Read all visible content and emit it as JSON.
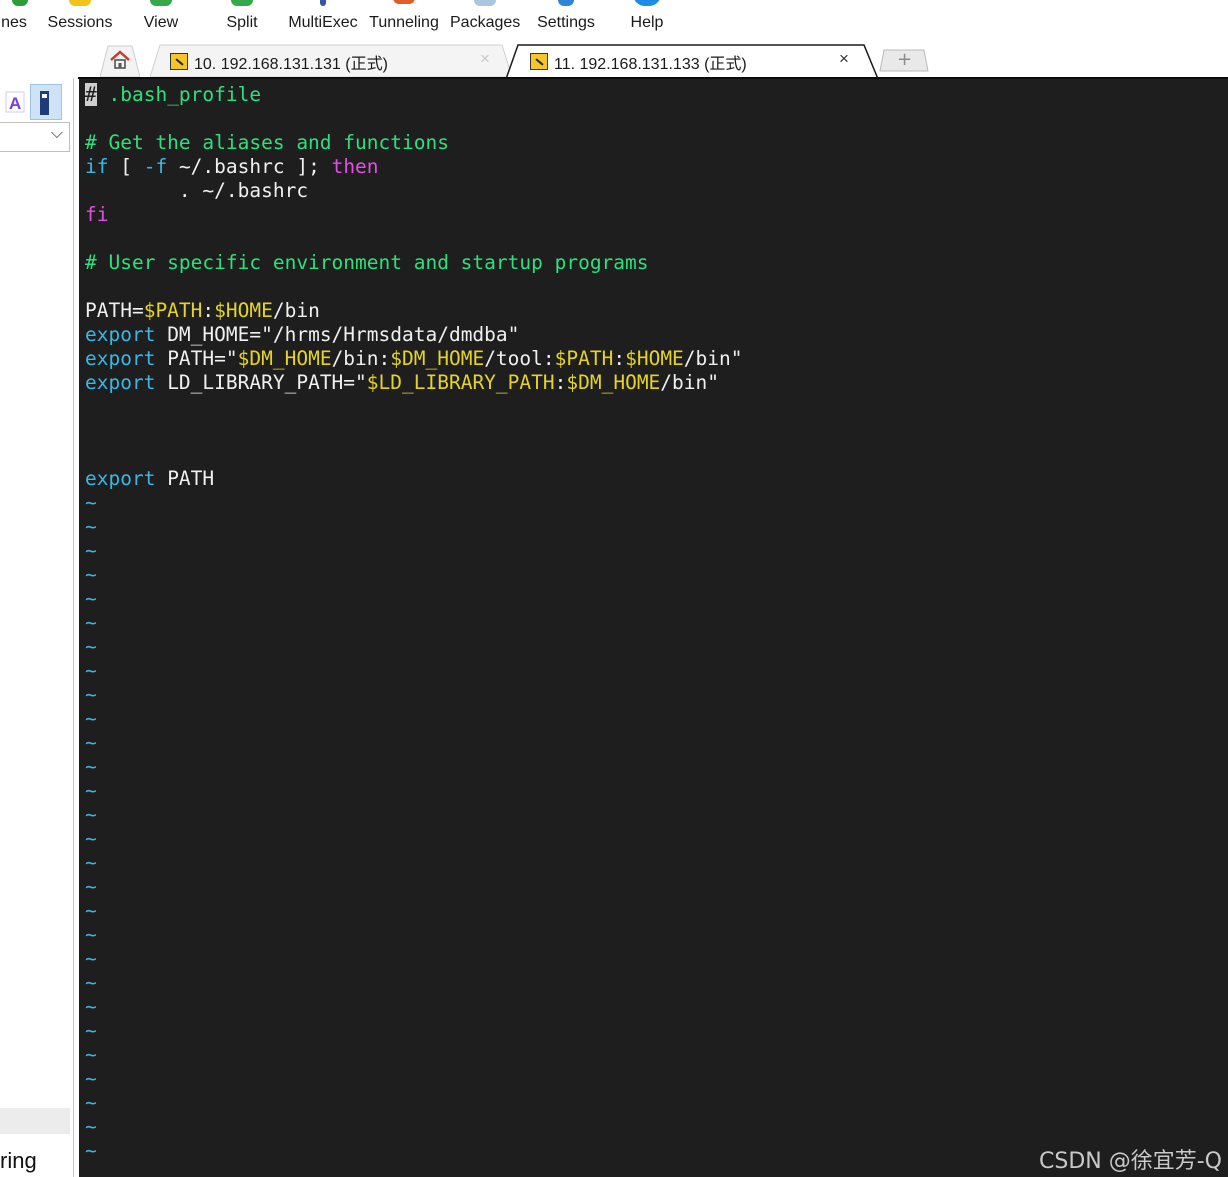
{
  "toolbar": {
    "items": [
      {
        "label": "nes",
        "icon": "sessions-partial-icon"
      },
      {
        "label": "Sessions",
        "icon": "star-icon"
      },
      {
        "label": "View",
        "icon": "view-icon"
      },
      {
        "label": "Split",
        "icon": "split-icon"
      },
      {
        "label": "MultiExec",
        "icon": "multiexec-icon"
      },
      {
        "label": "Tunneling",
        "icon": "tunneling-icon"
      },
      {
        "label": "Packages",
        "icon": "packages-icon"
      },
      {
        "label": "Settings",
        "icon": "gear-icon"
      },
      {
        "label": "Help",
        "icon": "help-icon"
      }
    ]
  },
  "tabs": {
    "home_icon": "home-icon",
    "items": [
      {
        "title": "10. 192.168.131.131 (正式)",
        "active": false
      },
      {
        "title": "11. 192.168.131.133 (正式)",
        "active": true
      }
    ],
    "close_glyph": "×",
    "new_tab_glyph": "+"
  },
  "sidebar": {
    "bottom_text": "ring"
  },
  "terminal": {
    "lines": [
      [
        {
          "t": "#",
          "c": "cursor"
        },
        {
          "t": " .bash_profile",
          "c": "comment"
        }
      ],
      [],
      [
        {
          "t": "# Get the aliases and functions",
          "c": "comment"
        }
      ],
      [
        {
          "t": "if",
          "c": "kw"
        },
        {
          "t": " [ ",
          "c": "plain"
        },
        {
          "t": "-f",
          "c": "kw"
        },
        {
          "t": " ~/.bashrc ]; ",
          "c": "plain"
        },
        {
          "t": "then",
          "c": "magenta"
        }
      ],
      [
        {
          "t": "        . ~/.bashrc",
          "c": "plain"
        }
      ],
      [
        {
          "t": "fi",
          "c": "magenta"
        }
      ],
      [],
      [
        {
          "t": "# User specific environment and startup programs",
          "c": "comment"
        }
      ],
      [],
      [
        {
          "t": "PATH=",
          "c": "plain"
        },
        {
          "t": "$PATH",
          "c": "var"
        },
        {
          "t": ":",
          "c": "plain"
        },
        {
          "t": "$HOME",
          "c": "var"
        },
        {
          "t": "/bin",
          "c": "plain"
        }
      ],
      [
        {
          "t": "export",
          "c": "kw"
        },
        {
          "t": " DM_HOME=\"/hrms/Hrmsdata/dmdba\"",
          "c": "plain"
        }
      ],
      [
        {
          "t": "export",
          "c": "kw"
        },
        {
          "t": " PATH=\"",
          "c": "plain"
        },
        {
          "t": "$DM_HOME",
          "c": "var"
        },
        {
          "t": "/bin:",
          "c": "plain"
        },
        {
          "t": "$DM_HOME",
          "c": "var"
        },
        {
          "t": "/tool:",
          "c": "plain"
        },
        {
          "t": "$PATH",
          "c": "var"
        },
        {
          "t": ":",
          "c": "plain"
        },
        {
          "t": "$HOME",
          "c": "var"
        },
        {
          "t": "/bin\"",
          "c": "plain"
        }
      ],
      [
        {
          "t": "export",
          "c": "kw"
        },
        {
          "t": " LD_LIBRARY_PATH=\"",
          "c": "plain"
        },
        {
          "t": "$LD_LIBRARY_PATH",
          "c": "var"
        },
        {
          "t": ":",
          "c": "plain"
        },
        {
          "t": "$DM_HOME",
          "c": "var"
        },
        {
          "t": "/bin\"",
          "c": "plain"
        }
      ],
      [],
      [],
      [],
      [
        {
          "t": "export",
          "c": "kw"
        },
        {
          "t": " PATH",
          "c": "plain"
        }
      ]
    ],
    "tilde_glyph": "~",
    "tilde_count": 28
  },
  "watermark": "CSDN @徐宜芳-Q",
  "colors": {
    "terminal_bg": "#1e1e1e",
    "comment": "#2fe07a",
    "keyword": "#3ab7e6",
    "magenta": "#e44ee4",
    "variable": "#e3d32a",
    "plain": "#f0f0f0"
  }
}
